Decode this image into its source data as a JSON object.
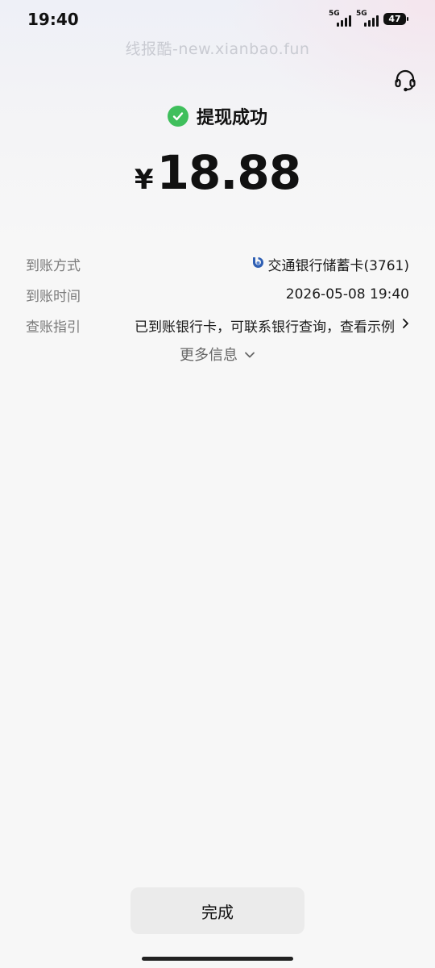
{
  "status_bar": {
    "time": "19:40",
    "signal1_label": "5G",
    "signal2_label": "5G",
    "battery": "47"
  },
  "watermark": "线报酷-new.xianbao.fun",
  "result": {
    "title": "提现成功",
    "currency": "¥",
    "amount": "18.88"
  },
  "details": {
    "method_label": "到账方式",
    "method_value": "交通银行储蓄卡(3761)",
    "time_label": "到账时间",
    "time_value": "2026-05-08 19:40",
    "guide_label": "查账指引",
    "guide_value": "已到账银行卡，可联系银行查询，查看示例"
  },
  "more_info": "更多信息",
  "done_label": "完成",
  "colors": {
    "success_green": "#3fbf5c",
    "bank_blue": "#2f5fb3"
  },
  "icons": [
    "headset-icon",
    "check-icon",
    "bank-logo-icon",
    "chevron-right-icon",
    "chevron-down-icon"
  ]
}
